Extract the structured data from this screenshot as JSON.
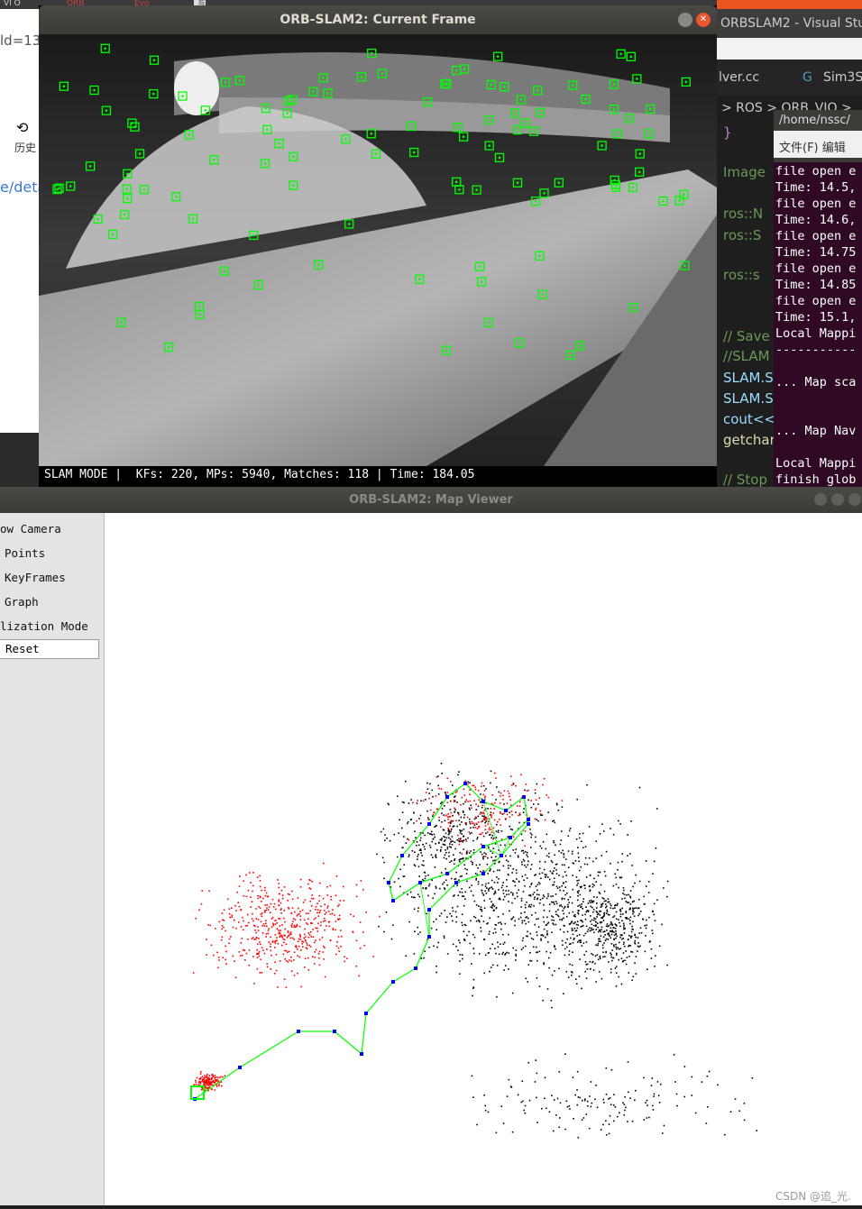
{
  "taskbar": {
    "tabs": [
      "VI O",
      "ORB",
      "Evo",
      "写"
    ]
  },
  "browser": {
    "url_fragment": "ld=13",
    "history_label": "历史",
    "link_fragment": "e/deta"
  },
  "vscode": {
    "title": "ORBSLAM2 - Visual Stu",
    "tabs": [
      "lver.cc",
      "Sim3S"
    ],
    "breadcrumb": "> ROS > ORB_VIO >",
    "code_lines": [
      {
        "text": "}",
        "color": "#c586c0"
      },
      {
        "text": "Image",
        "color": "#6a9955"
      },
      {
        "text": "ros::N",
        "color": "#6a9955"
      },
      {
        "text": "ros::S",
        "color": "#6a9955"
      },
      {
        "text": "ros::s",
        "color": "#6a9955"
      },
      {
        "text": "// Save",
        "color": "#6a9955"
      },
      {
        "text": "//SLAM",
        "color": "#6a9955"
      },
      {
        "text": "SLAM.S",
        "color": "#9cdcfe"
      },
      {
        "text": "SLAM.S",
        "color": "#9cdcfe"
      },
      {
        "text": "cout<<",
        "color": "#9cdcfe"
      },
      {
        "text": "getchar",
        "color": "#dcdcaa"
      },
      {
        "text": "// Stop",
        "color": "#6a9955"
      }
    ]
  },
  "terminal": {
    "path": "/home/nssc/",
    "menu": "文件(F)  编辑",
    "lines": [
      "file open e",
      "Time: 14.5,",
      "file open e",
      "Time: 14.6,",
      "file open e",
      "Time: 14.75",
      "file open e",
      "Time: 14.85",
      "file open e",
      "Time: 15.1,",
      "Local Mappi",
      "-----------",
      "",
      "... Map sca",
      "",
      "",
      "... Map Nav",
      "",
      "Local Mappi",
      "finish glob"
    ]
  },
  "current_frame": {
    "title": "ORB-SLAM2: Current Frame",
    "status": "SLAM MODE |  KFs: 220, MPs: 5940, Matches: 118 | Time: 184.05",
    "keypoint_color": "#00ff00"
  },
  "map_viewer": {
    "title": "ORB-SLAM2: Map Viewer",
    "menu": [
      "ow Camera",
      "Points",
      "KeyFrames",
      "Graph",
      "lization Mode"
    ],
    "reset_label": "Reset",
    "colors": {
      "map_points": "#000000",
      "local_points": "#ff0000",
      "keyframes": "#0000ff",
      "graph": "#00ff00"
    }
  },
  "watermark": "CSDN @追_光."
}
